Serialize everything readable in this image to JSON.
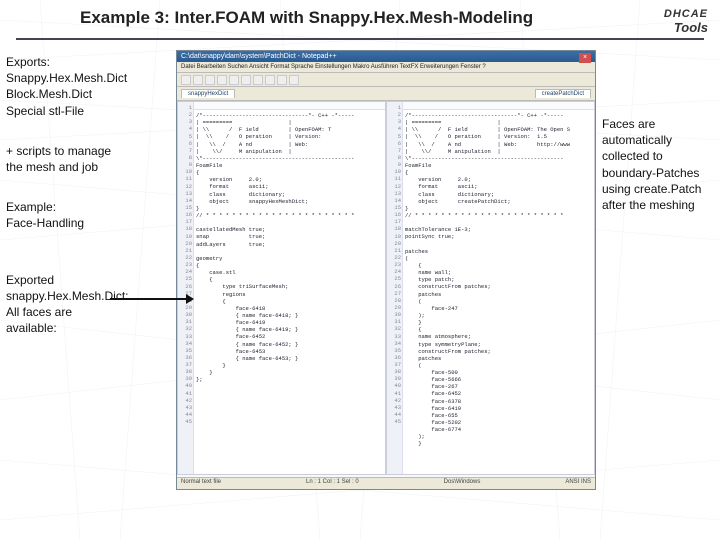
{
  "header": {
    "title": "Example 3: Inter.FOAM with Snappy.Hex.Mesh-Modeling",
    "logo_top": "DHCAE",
    "logo_bottom": "Tools"
  },
  "left": {
    "exports_heading": "Exports:",
    "exports_l1": "Snappy.Hex.Mesh.Dict",
    "exports_l2": "Block.Mesh.Dict",
    "exports_l3": "Special stl-File",
    "scripts_l1": "+ scripts to manage",
    "scripts_l2": "the mesh and job",
    "example_l1": "Example:",
    "example_l2": "Face-Handling",
    "exported_l1": "Exported",
    "exported_l2": "snappy.Hex.Mesh.Dict:",
    "exported_l3": "All faces are",
    "exported_l4": "available:"
  },
  "right": {
    "r1": "Faces are",
    "r2": "automatically",
    "r3": "collected to",
    "r4": "boundary-Patches",
    "r5": "using create.Patch",
    "r6": "after the meshing"
  },
  "editor": {
    "window_title": "C:\\dat\\snappy\\dam\\system\\PatchDict - Notepad++",
    "menus": "Datei  Bearbeiten  Suchen  Ansicht  Format  Sprache  Einstellungen  Makro  Ausführen  TextFX  Erweiterungen  Fenster  ?",
    "tab1": "snappyHexDict",
    "tab2": "createPatchDict",
    "status_left": "Normal text file",
    "status_ln": "Ln : 1    Col : 1    Sel : 0",
    "status_mid": "Dos\\Windows",
    "status_right": "ANSI        INS",
    "close": "×",
    "line_numbers_left": "1\n2\n3\n4\n5\n6\n7\n8\n9\n10\n11\n12\n13\n14\n15\n16\n17\n18\n19\n20\n21\n22\n23\n24\n25\n26\n27\n28\n29\n30\n31\n32\n33\n34\n35\n36\n37\n38\n39\n40\n41\n42\n43\n44\n45",
    "line_numbers_right": "1\n2\n3\n4\n5\n6\n7\n8\n9\n10\n11\n12\n13\n14\n15\n16\n17\n18\n19\n20\n21\n22\n23\n24\n25\n26\n27\n28\n29\n30\n31\n32\n33\n34\n35\n36\n37\n38\n39\n40\n41\n42\n43\n44\n45",
    "code_left": "/*--------------------------------*- C++ -*-----\n| =========                 |\n| \\\\      /  F ield         | OpenFOAM: T\n|  \\\\    /   O peration     | Version:\n|   \\\\  /    A nd           | Web:\n|    \\\\/     M anipulation  |\n\\*----------------------------------------------\nFoamFile\n{\n    version     2.0;\n    format      ascii;\n    class       dictionary;\n    object      snappyHexMeshDict;\n}\n// * * * * * * * * * * * * * * * * * * * * * * *\n\ncastellatedMesh true;\nsnap            true;\naddLayers       true;\n\ngeometry\n{\n    case.stl\n    {\n        type triSurfaceMesh;\n        regions\n        {\n            face-6418\n            { name face-6418; }\n            face-6419\n            { name face-6419; }\n            face-6452\n            { name face-6452; }\n            face-6453\n            { name face-6453; }\n        }\n    }\n};",
    "code_right": "/*--------------------------------*- C++ -*-----\n| =========                 |\n| \\\\      /  F ield         | OpenFOAM: The Open S\n|  \\\\    /   O peration     | Version:  1.5\n|   \\\\  /    A nd           | Web:      http://www\n|    \\\\/     M anipulation  |\n\\*----------------------------------------------\nFoamFile\n{\n    version     2.0;\n    format      ascii;\n    class       dictionary;\n    object      createPatchDict;\n}\n// * * * * * * * * * * * * * * * * * * * * * * *\n\nmatchTolerance 1E-3;\npointSync true;\n\npatches\n(\n    {\n    name wall;\n    type patch;\n    constructFrom patches;\n    patches\n    (\n        face-247\n    );\n    }\n    {\n    name atmosphere;\n    type symmetryPlane;\n    constructFrom patches;\n    patches\n    (\n        face-500\n        face-5666\n        face-267\n        face-6452\n        face-6378\n        face-6419\n        face-655\n        face-5202\n        face-6774\n    );\n    }"
  }
}
